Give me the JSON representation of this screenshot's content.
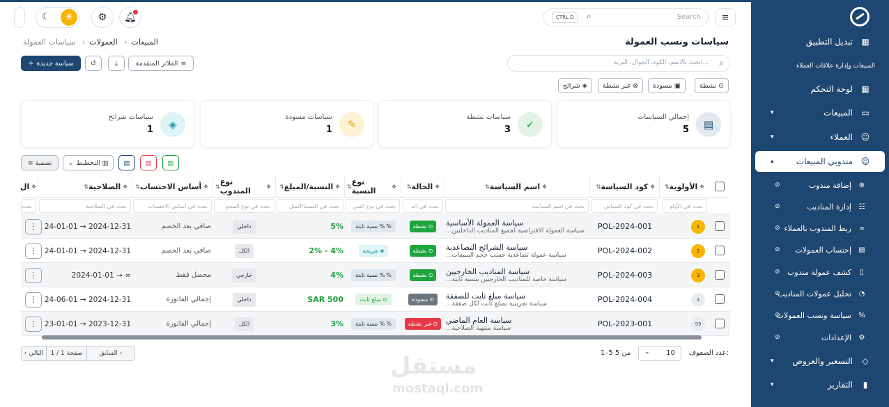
{
  "topbar": {
    "search_placeholder": "Search",
    "shortcut": "CTRL D"
  },
  "sidebar": {
    "caption": "المبيعات وإدارة علاقات العملاء",
    "items": [
      {
        "label": "تبديل التطبيق",
        "icon": "grid-icon"
      },
      {
        "label": "لوحة التحكم",
        "icon": "dashboard-icon"
      },
      {
        "label": "المبيعات",
        "icon": "cart-icon"
      },
      {
        "label": "العملاء",
        "icon": "user-icon"
      },
      {
        "label": "مندوبي المبيعات",
        "icon": "user-tie-icon"
      },
      {
        "label": "التسعير والعروض",
        "icon": "tag-icon"
      },
      {
        "label": "التقارير",
        "icon": "chart-icon"
      }
    ],
    "sub_items": [
      {
        "label": "إضافة مندوب"
      },
      {
        "label": "إدارة المناديب"
      },
      {
        "label": "ربط المندوب بالعملاء"
      },
      {
        "label": "إحتساب العمولات"
      },
      {
        "label": "كشف عمولة مندوب"
      },
      {
        "label": "تحليل عمولات المناديب"
      },
      {
        "label": "سياسة ونسب العمولات"
      },
      {
        "label": "الإعدادات"
      }
    ]
  },
  "header": {
    "title": "سياسات ونسب العمولة",
    "breadcrumb": [
      "المبيعات",
      "العمولات",
      "سياسات العمولة"
    ],
    "search_placeholder": "ابحث بالاسم، الكود، الجوال، البريد...",
    "new_button": "سياسة جديدة",
    "advanced_filters": "الفلاتر المتقدمة",
    "chips": [
      "نشطة",
      "مسودة",
      "غير نشطة",
      "شرائح"
    ]
  },
  "stats": [
    {
      "label": "إجمالي السياسات",
      "value": "5"
    },
    {
      "label": "سياسات نشطة",
      "value": "3"
    },
    {
      "label": "سياسات مسودة",
      "value": "1"
    },
    {
      "label": "سياسات شرائح",
      "value": "1"
    }
  ],
  "table_toolbar": {
    "layout": "التخطيط",
    "filter": "تصفية"
  },
  "table": {
    "columns": [
      "الأولوية",
      "كود السياسة",
      "اسم السياسة",
      "الحالة",
      "نوع النسبة",
      "النسبة/المبلغ",
      "نوع المندوب",
      "أساس الاحتساب",
      "الصلاحية",
      "ال"
    ],
    "filters": [
      "بحث في الأولو",
      "بحث في كود السياس",
      "بحث في اسم السياسة",
      "بحث في الد",
      "بحث في نوع النس",
      "بحث في النسبة/المبل",
      "بحث في نوع المندو",
      "بحث في أساس الاحتساب",
      "بحث في الصلاحية",
      "بحث"
    ],
    "rows": [
      {
        "priority": "1",
        "code": "POL-2024-001",
        "name": "سياسة العمولة الأساسية",
        "desc": "سياسة العمولة الافتراضية لجميع المناديب الداخليين...",
        "status": "نشطة",
        "rate_type": "نسبة ثابتة %",
        "amount": "5%",
        "agent": "داخلي",
        "basis": "صافي بعد الخصم",
        "validity": "2024-01-01 → 2024-12-31"
      },
      {
        "priority": "2",
        "code": "POL-2024-002",
        "name": "سياسة الشرائح التصاعدية",
        "desc": "سياسة عمولة تصاعدية حسب حجم المبيعات...",
        "status": "نشطة",
        "rate_type": "شريحة",
        "amount": "2% - 4%",
        "agent": "الكل",
        "basis": "صافي بعد الخصم",
        "validity": "2024-01-01 → 2024-12-31"
      },
      {
        "priority": "3",
        "code": "POL-2024-003",
        "name": "سياسة المناديب الخارجيين",
        "desc": "سياسة خاصة للمناديب الخارجيين بنسبة ثابتة...",
        "status": "نشطة",
        "rate_type": "نسبة ثابتة %",
        "amount": "4%",
        "agent": "خارجي",
        "basis": "محصل فقط",
        "validity": "2024-01-01 → ∞"
      },
      {
        "priority": "4",
        "code": "POL-2024-004",
        "name": "سياسة مبلغ ثابت للصفقة",
        "desc": "سياسة تجريبية بمبلغ ثابت لكل صفقة...",
        "status": "مسودة",
        "rate_type": "مبلغ ثابت",
        "amount": "SAR 500",
        "agent": "داخلي",
        "basis": "إجمالي الفاتورة",
        "validity": "2024-06-01 → 2024-12-31"
      },
      {
        "priority": "99",
        "code": "POL-2023-001",
        "name": "سياسة العام الماضي",
        "desc": "سياسة منتهية الصلاحية...",
        "status": "غير نشطة",
        "rate_type": "نسبة ثابتة %",
        "amount": "3%",
        "agent": "الكل",
        "basis": "إجمالي الفاتورة",
        "validity": "2023-01-01 → 2023-12-31"
      }
    ]
  },
  "pagination": {
    "rows_per_page_label": "عدد الصفوف:",
    "rows_per_page": "10",
    "range": "1–5 من 5",
    "prev": "السابق",
    "page": "صفحة 1 / 1",
    "next": "التالي"
  },
  "watermark": {
    "line1": "مستقل",
    "line2": "mostaql.com"
  },
  "colors": {
    "brand": "#1d4670",
    "active": "#1ea53c",
    "draft": "#6c757d",
    "inactive": "#e53945",
    "sun": "#f7b500"
  }
}
